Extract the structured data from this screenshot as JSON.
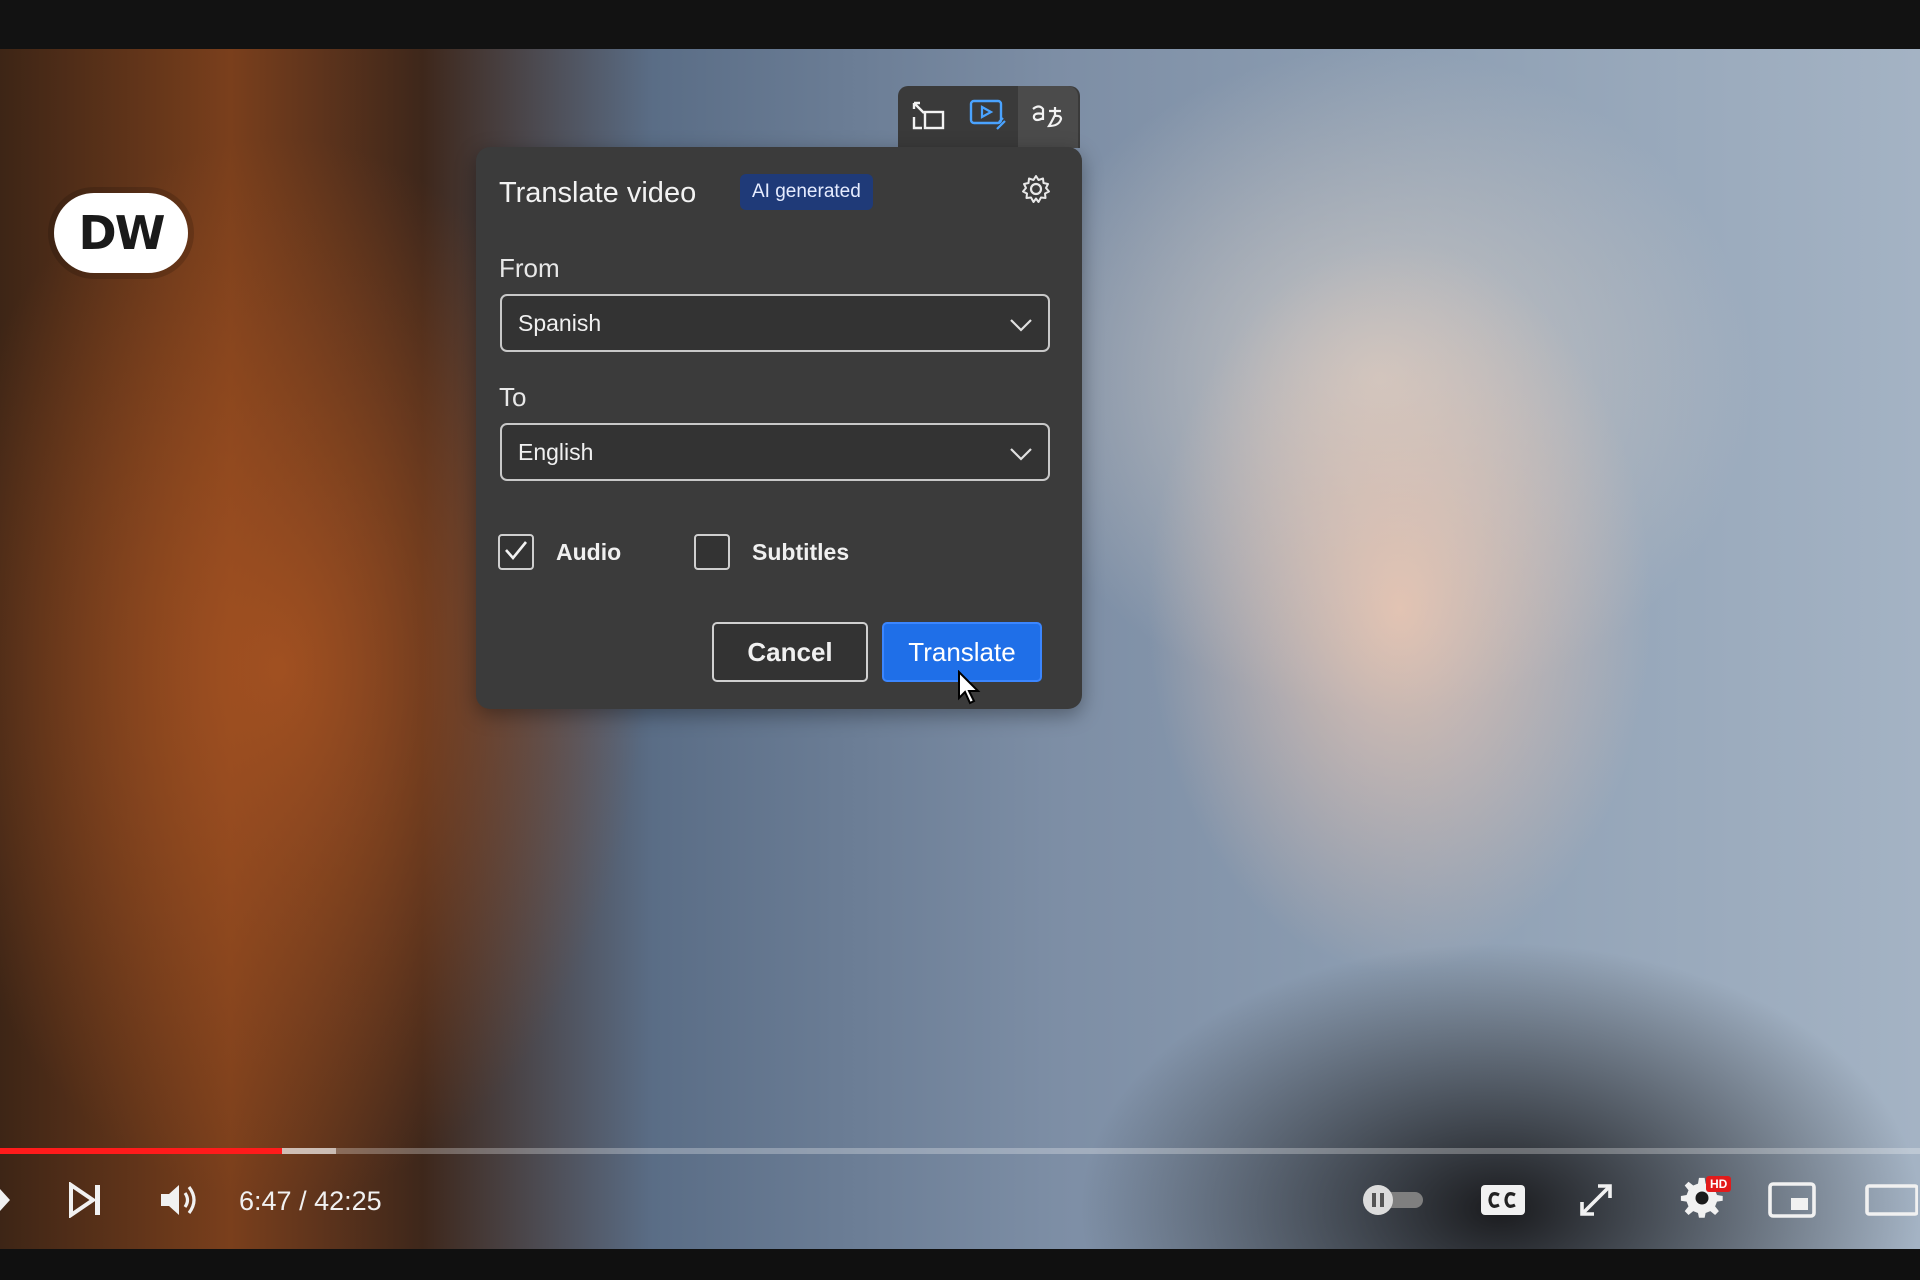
{
  "player": {
    "logo_text": "DW",
    "time_current": "6:47",
    "time_separator": " / ",
    "time_total": "42:25",
    "progress_played": 0.147,
    "progress_buffered": 0.175,
    "settings_badge": "HD",
    "accent_color": "#ff1b1b"
  },
  "toolbar": {
    "icons": [
      "picture-in-picture-swap-icon",
      "video-ai-icon",
      "translate-icon"
    ]
  },
  "translate_panel": {
    "title": "Translate video",
    "badge": "AI generated",
    "from_label": "From",
    "from_value": "Spanish",
    "to_label": "To",
    "to_value": "English",
    "audio_label": "Audio",
    "audio_checked": true,
    "subtitles_label": "Subtitles",
    "subtitles_checked": false,
    "cancel_label": "Cancel",
    "translate_label": "Translate",
    "primary_color": "#1f6fe8"
  }
}
